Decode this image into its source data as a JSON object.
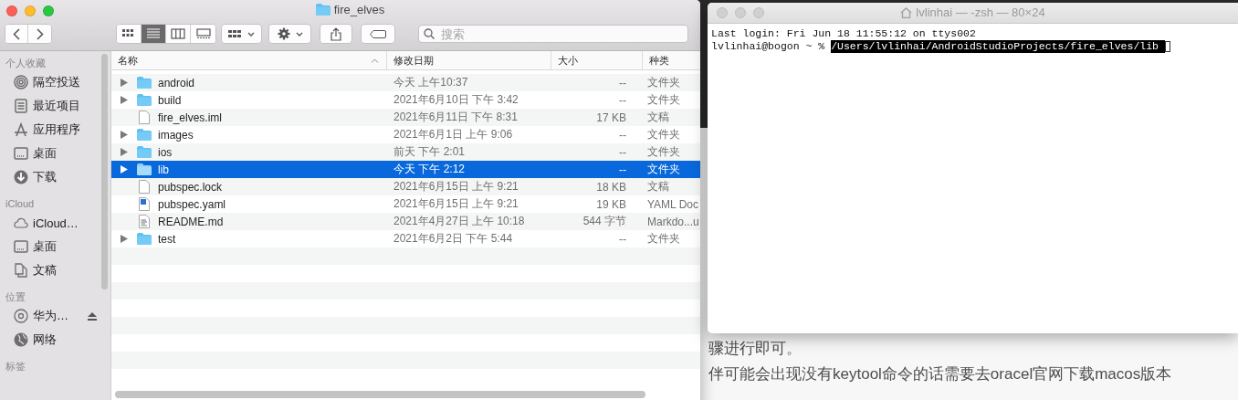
{
  "finder": {
    "title": "fire_elves",
    "view_modes": [
      {
        "selected": false
      },
      {
        "selected": true
      },
      {
        "selected": false
      },
      {
        "selected": false
      }
    ],
    "search": {
      "placeholder": "搜索"
    },
    "sidebar": [
      {
        "heading": "个人收藏",
        "items": [
          {
            "label": "隔空投送"
          },
          {
            "label": "最近项目"
          },
          {
            "label": "应用程序"
          },
          {
            "label": "桌面"
          },
          {
            "label": "下载"
          }
        ]
      },
      {
        "heading": "iCloud",
        "items": [
          {
            "label": "iCloud…"
          },
          {
            "label": "桌面"
          },
          {
            "label": "文稿"
          }
        ]
      },
      {
        "heading": "位置",
        "items": [
          {
            "label": "华为…",
            "ejectable": true
          },
          {
            "label": "网络",
            "ejectable": false
          }
        ]
      },
      {
        "heading": "标签"
      }
    ],
    "columns": [
      {
        "label": "名称",
        "sorted": true
      },
      {
        "label": "修改日期",
        "sorted": false
      },
      {
        "label": "大小",
        "sorted": false
      },
      {
        "label": "种类",
        "sorted": false
      }
    ],
    "rows": [
      {
        "kind": "folder",
        "name": "android",
        "date": "今天 上午10:37",
        "size": "--",
        "type": "文件夹",
        "selected": false
      },
      {
        "kind": "folder",
        "name": "build",
        "date": "2021年6月10日 下午 3:42",
        "size": "--",
        "type": "文件夹",
        "selected": false
      },
      {
        "kind": "file",
        "name": "fire_elves.iml",
        "date": "2021年6月11日 下午 8:31",
        "size": "17 KB",
        "type": "文稿",
        "selected": false
      },
      {
        "kind": "folder",
        "name": "images",
        "date": "2021年6月1日 上午 9:06",
        "size": "--",
        "type": "文件夹",
        "selected": false
      },
      {
        "kind": "folder",
        "name": "ios",
        "date": "前天 下午 2:01",
        "size": "--",
        "type": "文件夹",
        "selected": false
      },
      {
        "kind": "folder",
        "name": "lib",
        "date": "今天 下午 2:12",
        "size": "--",
        "type": "文件夹",
        "selected": true
      },
      {
        "kind": "file",
        "name": "pubspec.lock",
        "date": "2021年6月15日 上午 9:21",
        "size": "18 KB",
        "type": "文稿",
        "selected": false
      },
      {
        "kind": "yaml",
        "name": "pubspec.yaml",
        "date": "2021年6月15日 上午 9:21",
        "size": "19 KB",
        "type": "YAML Doc",
        "selected": false
      },
      {
        "kind": "markdown",
        "name": "README.md",
        "date": "2021年4月27日 上午 10:18",
        "size": "544 字节",
        "type": "Markdo...u",
        "selected": false
      },
      {
        "kind": "folder",
        "name": "test",
        "date": "2021年6月2日 下午 5:44",
        "size": "--",
        "type": "文件夹",
        "selected": false
      }
    ]
  },
  "terminal": {
    "title": "lvlinhai — -zsh — 80×24",
    "lines": [
      {
        "text": "Last login: Fri Jun 18 11:55:12 on ttys002"
      },
      {
        "text": "lvlinhai@bogon ~ % ",
        "selection": "/Users/lvlinhai/AndroidStudioProjects/fire_elves/lib "
      }
    ]
  },
  "article": {
    "lines": [
      "骤进行即可。",
      "伴可能会出现没有keytool命令的话需要去oracel官网下载macos版本"
    ]
  }
}
